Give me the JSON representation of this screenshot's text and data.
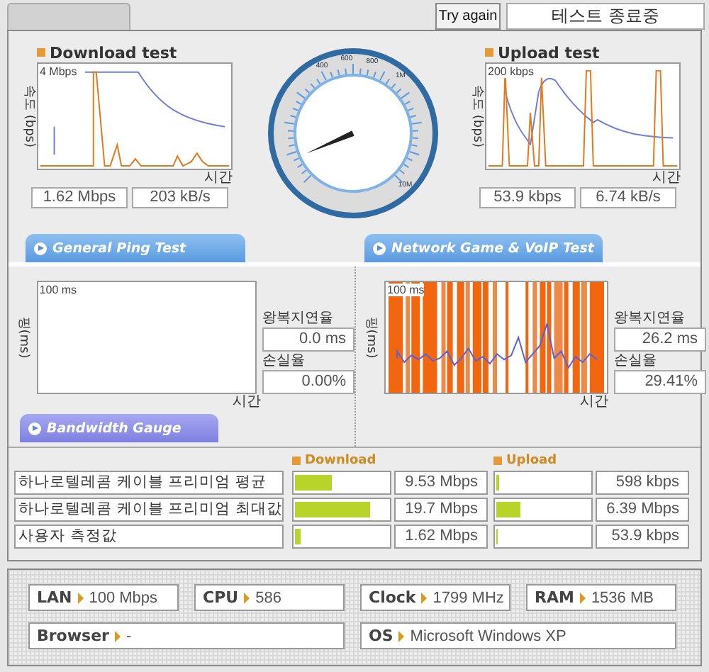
{
  "top_bar": {
    "try_again": "Try again",
    "status": "테스트 종료중"
  },
  "speed_tests": [
    {
      "kind": "download",
      "title": "Download test",
      "y_label": "속도 (bps)",
      "scale": "4 Mbps",
      "x_label": "시간",
      "readings": [
        "1.62 Mbps",
        "203 kB/s"
      ]
    },
    {
      "kind": "upload",
      "title": "Upload test",
      "y_label": "속도 (bps)",
      "scale": "200 kbps",
      "x_label": "시간",
      "readings": [
        "53.9 kbps",
        "6.74 kB/s"
      ]
    }
  ],
  "gauge": {
    "labels": [
      "400",
      "600",
      "800",
      "1M",
      "10M"
    ]
  },
  "ping_tests": [
    {
      "kind": "general",
      "title": "General Ping Test",
      "y_label": "핑(ms)",
      "scale": "100 ms",
      "x_label": "시간",
      "latency_label": "왕복지연율",
      "latency": "0.0 ms",
      "loss_label": "손실율",
      "loss": "0.00%"
    },
    {
      "kind": "game",
      "title": "Network Game & VoIP Test",
      "y_label": "핑(ms)",
      "scale": "100 ms",
      "x_label": "시간",
      "latency_label": "왕복지연율",
      "latency": "26.2 ms",
      "loss_label": "손실율",
      "loss": "29.41%"
    }
  ],
  "bandwidth": {
    "title": "Bandwidth Gauge",
    "columns": [
      "Download",
      "Upload"
    ],
    "rows": [
      {
        "name": "하나로텔레콤 케이블 프리미엄 평균",
        "download": {
          "level": 0.4,
          "reading": "9.53 Mbps"
        },
        "upload": {
          "level": 0.03,
          "reading": "598 kbps"
        }
      },
      {
        "name": "하나로텔레콤 케이블 프리미엄 최대값",
        "download": {
          "level": 0.8,
          "reading": "19.7 Mbps"
        },
        "upload": {
          "level": 0.25,
          "reading": "6.39 Mbps"
        }
      },
      {
        "name": "사용자 측정값",
        "download": {
          "level": 0.06,
          "reading": "1.62 Mbps"
        },
        "upload": {
          "level": 0,
          "reading": "53.9 kbps"
        }
      }
    ]
  },
  "system_info": [
    {
      "label": "LAN",
      "value": "100 Mbps"
    },
    {
      "label": "CPU",
      "value": "586"
    },
    {
      "label": "Clock",
      "value": "1799 MHz"
    },
    {
      "label": "RAM",
      "value": "1536 MB"
    },
    {
      "label": "Browser",
      "value": "-"
    },
    {
      "label": "OS",
      "value": "Microsoft Windows XP"
    }
  ]
}
